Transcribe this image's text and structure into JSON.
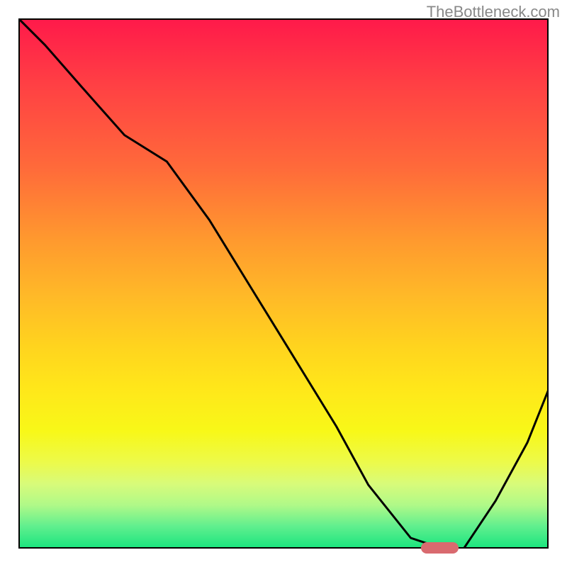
{
  "watermark": "TheBottleneck.com",
  "chart_data": {
    "type": "line",
    "title": "",
    "xlabel": "",
    "ylabel": "",
    "xlim": [
      0,
      100
    ],
    "ylim": [
      0,
      100
    ],
    "series": [
      {
        "name": "curve",
        "x": [
          0,
          5,
          12,
          20,
          28,
          36,
          44,
          52,
          60,
          66,
          74,
          80,
          84,
          90,
          96,
          100
        ],
        "values": [
          100,
          95,
          87,
          78,
          73,
          62,
          49,
          36,
          23,
          12,
          2,
          0,
          0,
          9,
          20,
          30
        ]
      }
    ],
    "marker": {
      "x_start": 76,
      "x_end": 83,
      "y": 0
    },
    "background_gradient": {
      "top": "#ff1a4a",
      "bottom": "#1de57f"
    }
  }
}
